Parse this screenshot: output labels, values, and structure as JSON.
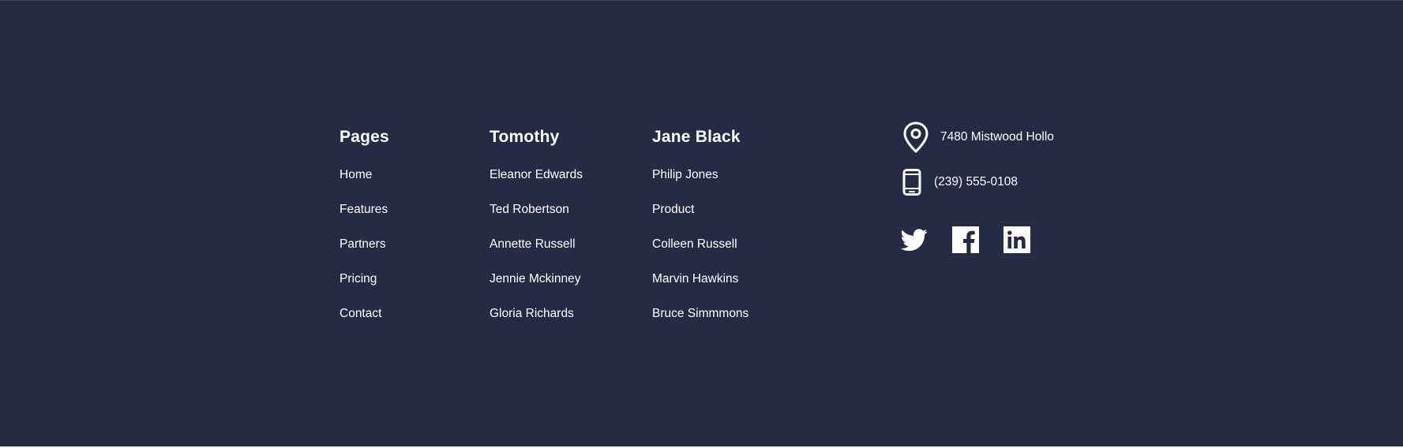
{
  "footer": {
    "columns": [
      {
        "heading": "Pages",
        "links": [
          "Home",
          "Features",
          "Partners",
          "Pricing",
          "Contact"
        ]
      },
      {
        "heading": "Tomothy",
        "links": [
          "Eleanor Edwards",
          "Ted Robertson",
          "Annette Russell",
          "Jennie Mckinney",
          "Gloria Richards"
        ]
      },
      {
        "heading": "Jane Black",
        "links": [
          "Philip Jones",
          "Product",
          "Colleen Russell",
          "Marvin Hawkins",
          "Bruce Simmmons"
        ]
      }
    ],
    "contact": {
      "address": "7480 Mistwood Hollo",
      "address_icon": "location-pin-icon",
      "phone": "(239) 555-0108",
      "phone_icon": "mobile-phone-icon"
    },
    "social": [
      {
        "name": "twitter",
        "icon": "twitter-icon"
      },
      {
        "name": "facebook",
        "icon": "facebook-icon"
      },
      {
        "name": "linkedin",
        "icon": "linkedin-icon"
      }
    ]
  },
  "colors": {
    "background": "#252b45",
    "text": "#ffffff"
  }
}
